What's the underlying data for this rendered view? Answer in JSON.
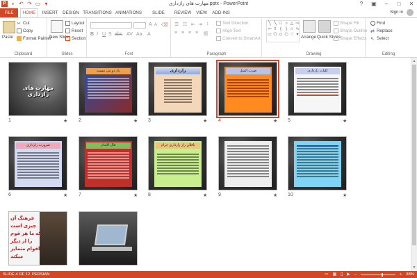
{
  "app": {
    "title": "مهارت های رازداری.pptx - PowerPoint",
    "signin": "Sign in",
    "accent": "#d24726"
  },
  "tabs": [
    {
      "label": "FILE"
    },
    {
      "label": "HOME"
    },
    {
      "label": "INSERT"
    },
    {
      "label": "DESIGN"
    },
    {
      "label": "TRANSITIONS"
    },
    {
      "label": "ANIMATIONS"
    },
    {
      "label": "SLIDE SHOW"
    },
    {
      "label": "REVIEW"
    },
    {
      "label": "VIEW"
    },
    {
      "label": "ADD-INS"
    }
  ],
  "ribbon": {
    "clipboard": {
      "label": "Clipboard",
      "paste": "Paste",
      "cut": "Cut",
      "copy": "Copy",
      "format_painter": "Format Painter"
    },
    "slides": {
      "label": "Slides",
      "new_slide": "New Slide",
      "layout": "Layout",
      "reset": "Reset",
      "section": "Section"
    },
    "font": {
      "label": "Font"
    },
    "paragraph": {
      "label": "Paragraph",
      "text_direction": "Text Direction",
      "align_text": "Align Text",
      "convert_smartart": "Convert to SmartArt"
    },
    "drawing": {
      "label": "Drawing",
      "arrange": "Arrange",
      "quick_styles": "Quick Styles",
      "shape_fill": "Shape Fill",
      "shape_outline": "Shape Outline",
      "shape_effects": "Shape Effects"
    },
    "editing": {
      "label": "Editing",
      "find": "Find",
      "replace": "Replace",
      "select": "Select"
    }
  },
  "slides": [
    {
      "num": "1",
      "title": "مهارت های رازداری"
    },
    {
      "num": "2",
      "title": "راز دو تنی نیست"
    },
    {
      "num": "3",
      "title": "رازداری"
    },
    {
      "num": "4",
      "title": "ضرب المثل",
      "selected": true
    },
    {
      "num": "5",
      "title": "کلیات رازداری"
    },
    {
      "num": "6",
      "title": "ضرورت رازداری"
    },
    {
      "num": "7",
      "title": "قال الامام"
    },
    {
      "num": "8",
      "title": "ناقلان راز رازداری حرام"
    },
    {
      "num": "9",
      "title": ""
    },
    {
      "num": "10",
      "title": ""
    },
    {
      "num": "11",
      "title": "فرهنگ آن چیزی است که ما هر قوم را از دیگر اقوام متمایز میکند"
    },
    {
      "num": "12",
      "title": ""
    }
  ],
  "status": {
    "slide_info": "SLIDE 4 OF 12",
    "language": "PERSIAN",
    "zoom": "88%"
  }
}
